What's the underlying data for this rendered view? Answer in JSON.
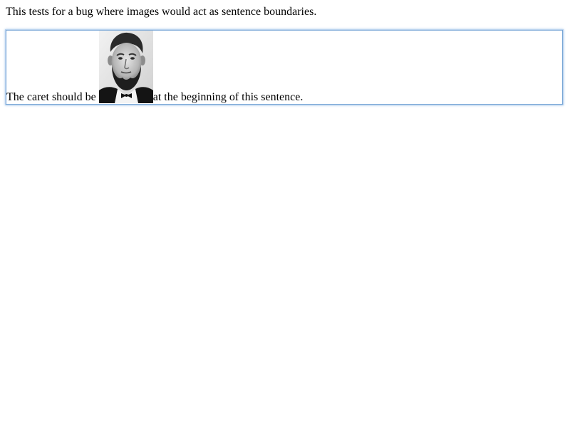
{
  "intro": {
    "text": "This tests for a bug where images would act as sentence boundaries."
  },
  "editor": {
    "before_image": "The caret should be",
    "after_image": "at the beginning of this sentence."
  }
}
